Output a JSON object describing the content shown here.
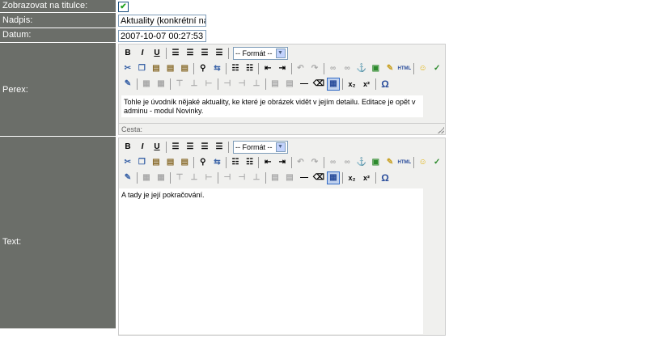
{
  "fields": {
    "show_on_title": {
      "label": "Zobrazovat na titulce:",
      "checked_glyph": "✔"
    },
    "title": {
      "label": "Nadpis:",
      "value": "Aktuality (konkrétní nadp"
    },
    "date": {
      "label": "Datum:",
      "value": "2007-10-07 00:27:53"
    },
    "perex": {
      "label": "Perex:"
    },
    "text": {
      "label": "Text:"
    }
  },
  "toolbar": {
    "bold": "B",
    "italic": "I",
    "underline": "U",
    "format_select": "-- Formát --",
    "subscript": "x₂",
    "superscript": "x²",
    "omega": "Ω",
    "html": "HTML"
  },
  "perex_editor": {
    "content": "Tohle je úvodník nějaké aktuality, ke které je obrázek vidět v jejím detailu. Editace je opět v adminu - modul Novinky.",
    "status_label": "Cesta:"
  },
  "text_editor": {
    "content": "A tady je její pokračování."
  },
  "colors": {
    "label_bg": "#6b6e69",
    "editor_bg": "#f0f0ee"
  }
}
